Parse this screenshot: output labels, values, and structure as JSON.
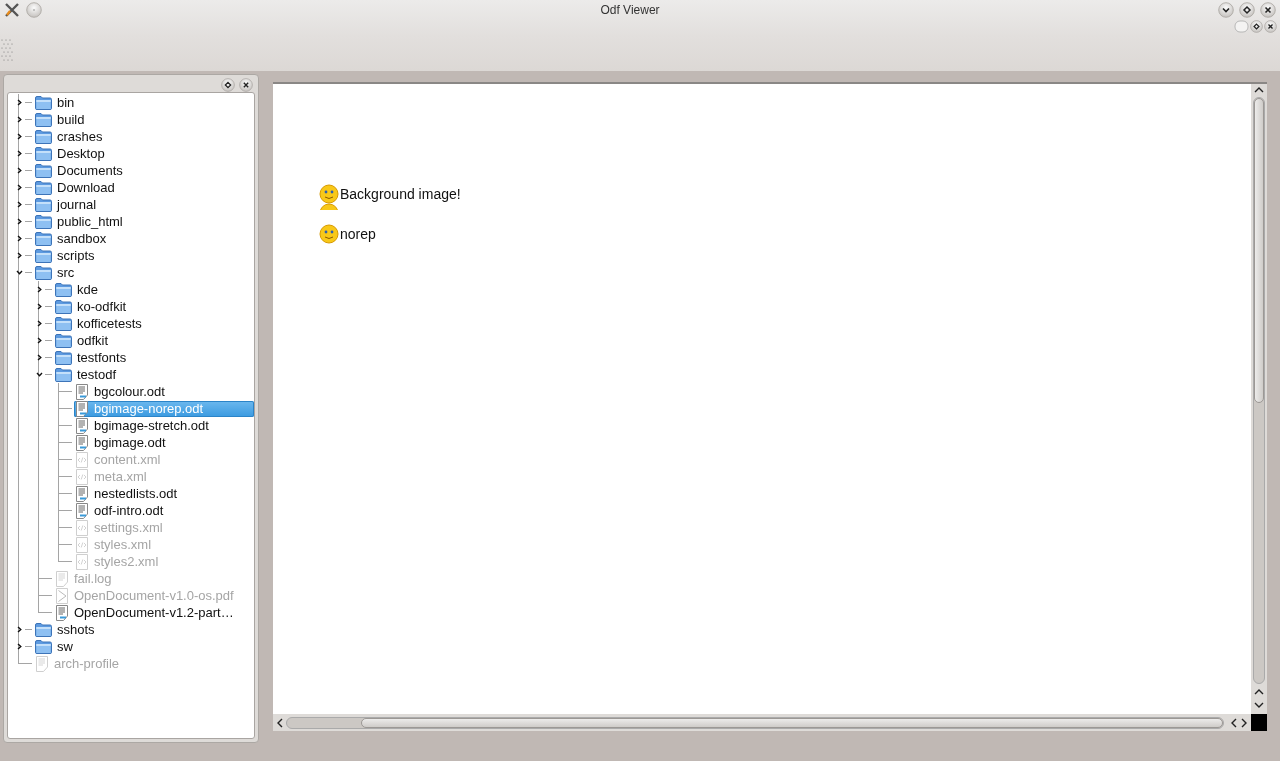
{
  "window": {
    "title": "Odf Viewer"
  },
  "file_tree": {
    "items": [
      {
        "label": "bin",
        "kind": "folder",
        "expanded": false,
        "selected": false,
        "disabled": false
      },
      {
        "label": "build",
        "kind": "folder",
        "expanded": false,
        "selected": false,
        "disabled": false
      },
      {
        "label": "crashes",
        "kind": "folder",
        "expanded": false,
        "selected": false,
        "disabled": false
      },
      {
        "label": "Desktop",
        "kind": "folder",
        "expanded": false,
        "selected": false,
        "disabled": false
      },
      {
        "label": "Documents",
        "kind": "folder",
        "expanded": false,
        "selected": false,
        "disabled": false
      },
      {
        "label": "Download",
        "kind": "folder",
        "expanded": false,
        "selected": false,
        "disabled": false
      },
      {
        "label": "journal",
        "kind": "folder",
        "expanded": false,
        "selected": false,
        "disabled": false
      },
      {
        "label": "public_html",
        "kind": "folder",
        "expanded": false,
        "selected": false,
        "disabled": false
      },
      {
        "label": "sandbox",
        "kind": "folder",
        "expanded": false,
        "selected": false,
        "disabled": false
      },
      {
        "label": "scripts",
        "kind": "folder",
        "expanded": false,
        "selected": false,
        "disabled": false
      },
      {
        "label": "src",
        "kind": "folder",
        "expanded": true,
        "selected": false,
        "disabled": false,
        "children": [
          {
            "label": "kde",
            "kind": "folder",
            "expanded": false,
            "selected": false,
            "disabled": false
          },
          {
            "label": "ko-odfkit",
            "kind": "folder",
            "expanded": false,
            "selected": false,
            "disabled": false
          },
          {
            "label": "kofficetests",
            "kind": "folder",
            "expanded": false,
            "selected": false,
            "disabled": false
          },
          {
            "label": "odfkit",
            "kind": "folder",
            "expanded": false,
            "selected": false,
            "disabled": false
          },
          {
            "label": "testfonts",
            "kind": "folder",
            "expanded": false,
            "selected": false,
            "disabled": false
          },
          {
            "label": "testodf",
            "kind": "folder",
            "expanded": true,
            "selected": false,
            "disabled": false,
            "children": [
              {
                "label": "bgcolour.odt",
                "kind": "document",
                "selected": false,
                "disabled": false
              },
              {
                "label": "bgimage-norep.odt",
                "kind": "document",
                "selected": true,
                "disabled": false
              },
              {
                "label": "bgimage-stretch.odt",
                "kind": "document",
                "selected": false,
                "disabled": false
              },
              {
                "label": "bgimage.odt",
                "kind": "document",
                "selected": false,
                "disabled": false
              },
              {
                "label": "content.xml",
                "kind": "xml",
                "selected": false,
                "disabled": true
              },
              {
                "label": "meta.xml",
                "kind": "xml",
                "selected": false,
                "disabled": true
              },
              {
                "label": "nestedlists.odt",
                "kind": "document",
                "selected": false,
                "disabled": false
              },
              {
                "label": "odf-intro.odt",
                "kind": "document",
                "selected": false,
                "disabled": false
              },
              {
                "label": "settings.xml",
                "kind": "xml",
                "selected": false,
                "disabled": true
              },
              {
                "label": "styles.xml",
                "kind": "xml",
                "selected": false,
                "disabled": true
              },
              {
                "label": "styles2.xml",
                "kind": "xml",
                "selected": false,
                "disabled": true
              }
            ]
          },
          {
            "label": "fail.log",
            "kind": "text",
            "selected": false,
            "disabled": true
          },
          {
            "label": "OpenDocument-v1.0-os.pdf",
            "kind": "pdf",
            "selected": false,
            "disabled": true
          },
          {
            "label": "OpenDocument-v1.2-part…",
            "kind": "document",
            "selected": false,
            "disabled": false
          }
        ]
      },
      {
        "label": "sshots",
        "kind": "folder",
        "expanded": false,
        "selected": false,
        "disabled": false
      },
      {
        "label": "sw",
        "kind": "folder",
        "expanded": false,
        "selected": false,
        "disabled": false
      },
      {
        "label": "arch-profile",
        "kind": "text",
        "selected": false,
        "disabled": true
      }
    ]
  },
  "document": {
    "paragraphs": [
      {
        "text": "Background image!"
      },
      {
        "text": "norep"
      }
    ]
  }
}
